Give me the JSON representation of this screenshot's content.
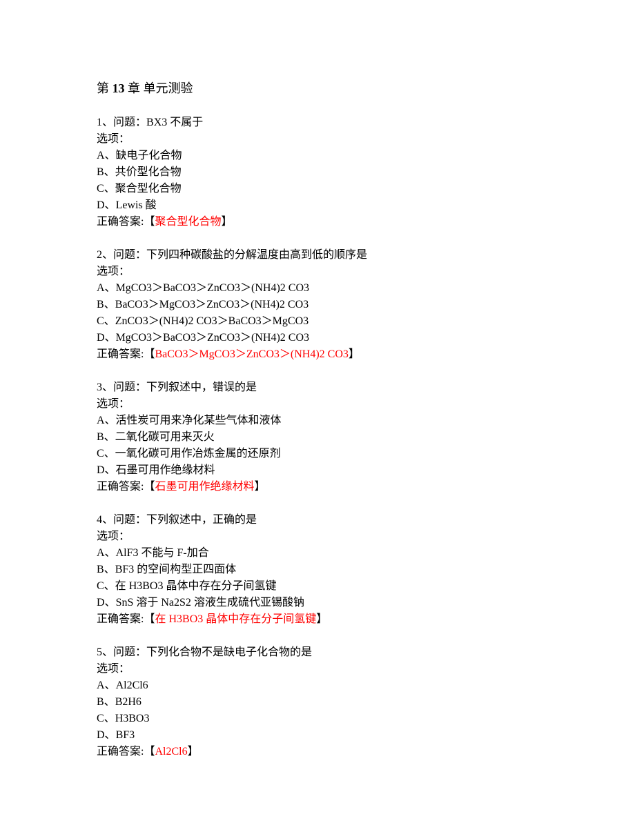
{
  "title_prefix": "第",
  "title_num": " 13 ",
  "title_rest": "章 单元测验",
  "options_label": "选项：",
  "answer_prefix": "正确答案:【",
  "answer_suffix": "】",
  "q1": {
    "prompt_a": "1、问题：",
    "prompt_b": "BX3 ",
    "prompt_c": "不属于",
    "A": "A、缺电子化合物",
    "B": "B、共价型化合物",
    "C": "C、聚合型化合物",
    "D_a": "D、",
    "D_b": "Lewis ",
    "D_c": "酸",
    "ans": "聚合型化合物"
  },
  "q2": {
    "prompt": "2、问题：下列四种碳酸盐的分解温度由高到低的顺序是",
    "A_a": "A、",
    "A_b": "MgCO3＞BaCO3＞ZnCO3＞(NH4)2 CO3",
    "B_a": "B、",
    "B_b": "BaCO3＞MgCO3＞ZnCO3＞(NH4)2 CO3",
    "C_a": "C、",
    "C_b": "ZnCO3＞(NH4)2 CO3＞BaCO3＞MgCO3",
    "D_a": "D、",
    "D_b": "MgCO3＞BaCO3＞ZnCO3＞(NH4)2 CO3",
    "ans": "BaCO3＞MgCO3＞ZnCO3＞(NH4)2 CO3"
  },
  "q3": {
    "prompt": "3、问题：下列叙述中，错误的是",
    "A": "A、活性炭可用来净化某些气体和液体",
    "B": "B、二氧化碳可用来灭火",
    "C": "C、一氧化碳可用作冶炼金属的还原剂",
    "D": "D、石墨可用作绝缘材料",
    "ans": "石墨可用作绝缘材料"
  },
  "q4": {
    "prompt": "4、问题：下列叙述中，正确的是",
    "A_a": "A、",
    "A_b": "AlF3 ",
    "A_c": "不能与",
    "A_d": " F-",
    "A_e": "加合",
    "B_a": "B、",
    "B_b": "BF3 ",
    "B_c": "的空间构型正四面体",
    "C_a": "C、在",
    "C_b": " H3BO3 ",
    "C_c": "晶体中存在分子间氢键",
    "D_a": "D、",
    "D_b": "SnS ",
    "D_c": "溶于",
    "D_d": " Na2S2 ",
    "D_e": "溶液生成硫代亚锡酸钠",
    "ans_a": "在",
    "ans_b": " H3BO3 ",
    "ans_c": "晶体中存在分子间氢键"
  },
  "q5": {
    "prompt": "5、问题：下列化合物不是缺电子化合物的是",
    "A_a": "A、",
    "A_b": "Al2Cl6",
    "B_a": "B、",
    "B_b": "B2H6",
    "C_a": "C、",
    "C_b": "H3BO3",
    "D_a": "D、",
    "D_b": "BF3",
    "ans": "Al2Cl6"
  }
}
